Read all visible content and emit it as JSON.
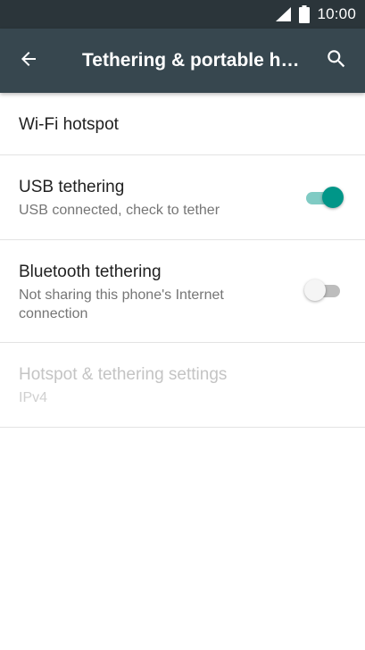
{
  "status_bar": {
    "time": "10:00",
    "icons": [
      "signal-icon",
      "battery-icon"
    ]
  },
  "toolbar": {
    "back_icon": "arrow-back-icon",
    "title": "Tethering & portable hotspot",
    "search_icon": "search-icon"
  },
  "items": {
    "wifi_hotspot": {
      "title": "Wi-Fi hotspot"
    },
    "usb_tethering": {
      "title": "USB tethering",
      "summary": "USB connected, check to tether",
      "switch_on": true
    },
    "bluetooth_tethering": {
      "title": "Bluetooth tethering",
      "summary": "Not sharing this phone's Internet connection",
      "switch_on": false
    },
    "hotspot_settings": {
      "title": "Hotspot & tethering settings",
      "summary": "IPv4",
      "enabled": false
    }
  },
  "colors": {
    "status_bar": "#2b353a",
    "toolbar": "#37474f",
    "accent": "#009688",
    "accent_track": "#80cbc4",
    "switch_off_thumb": "#f5f5f5",
    "switch_off_track": "#bdbdbd"
  }
}
